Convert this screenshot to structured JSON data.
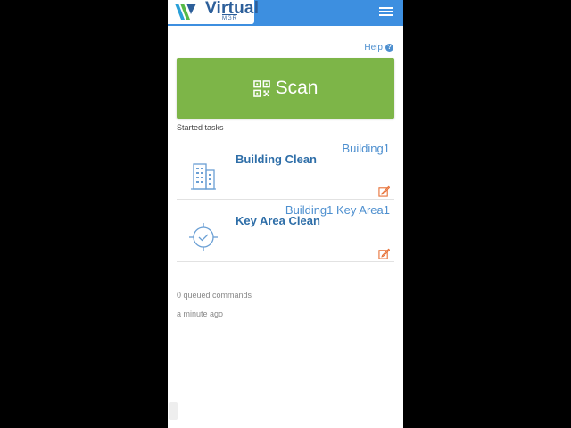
{
  "header": {
    "brand": "Virtual",
    "brand_sub": "MGR"
  },
  "help": {
    "label": "Help",
    "icon": "question-circle-icon"
  },
  "scan": {
    "label": "Scan",
    "icon": "qr-code-icon",
    "color": "#7db548"
  },
  "started_tasks": {
    "label": "Started tasks",
    "items": [
      {
        "title": "Building Clean",
        "location": "Building1",
        "icon": "building-icon"
      },
      {
        "title": "Key Area Clean",
        "location": "Building1 Key Area1",
        "icon": "target-check-icon"
      }
    ]
  },
  "status": {
    "queued": "0 queued commands",
    "updated": "a minute ago"
  },
  "colors": {
    "header": "#3d8fe0",
    "accent": "#4d8fcf",
    "edit": "#e8733a"
  }
}
